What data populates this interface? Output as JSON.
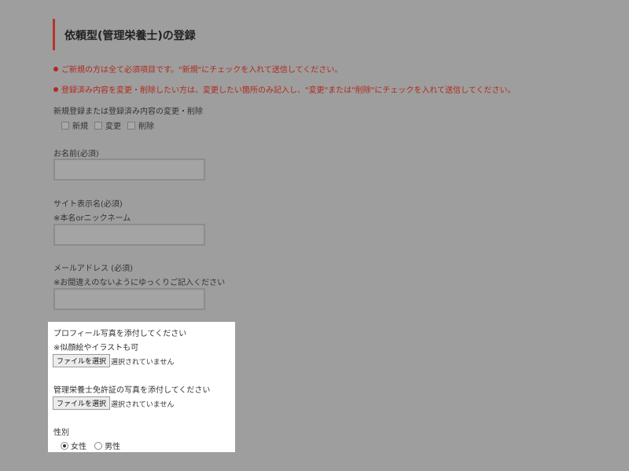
{
  "page": {
    "title": "依頼型(管理栄養士)の登録"
  },
  "notices": [
    "ご新規の方は全て必須項目です。\"新規\"にチェックを入れて送信してください。",
    "登録済み内容を変更・削除したい方は、変更したい箇所のみ記入し、\"変更\"または\"削除\"にチェックを入れて送信してください。"
  ],
  "action": {
    "label": "新規登録または登録済み内容の変更・削除",
    "options": [
      "新規",
      "変更",
      "削除"
    ]
  },
  "fields": {
    "name": {
      "label": "お名前(必須)",
      "value": ""
    },
    "display_name": {
      "label": "サイト表示名(必須)",
      "note": "※本名orニックネーム",
      "value": ""
    },
    "email": {
      "label": "メールアドレス (必須)",
      "note": "※お間違えのないようにゆっくりご記入ください",
      "value": ""
    }
  },
  "profile_photo": {
    "label": "プロフィール写真を添付してください",
    "note": "※似顔絵やイラストも可",
    "button": "ファイルを選択",
    "status": "選択されていません"
  },
  "license_photo": {
    "label": "管理栄養士免許証の写真を添付してください",
    "button": "ファイルを選択",
    "status": "選択されていません"
  },
  "gender": {
    "label": "性別",
    "options": [
      "女性",
      "男性"
    ],
    "selected": "女性"
  },
  "colors": {
    "overlay": "#9e9e9e",
    "accent_red": "#b02a1e",
    "panel": "#ffffff"
  }
}
